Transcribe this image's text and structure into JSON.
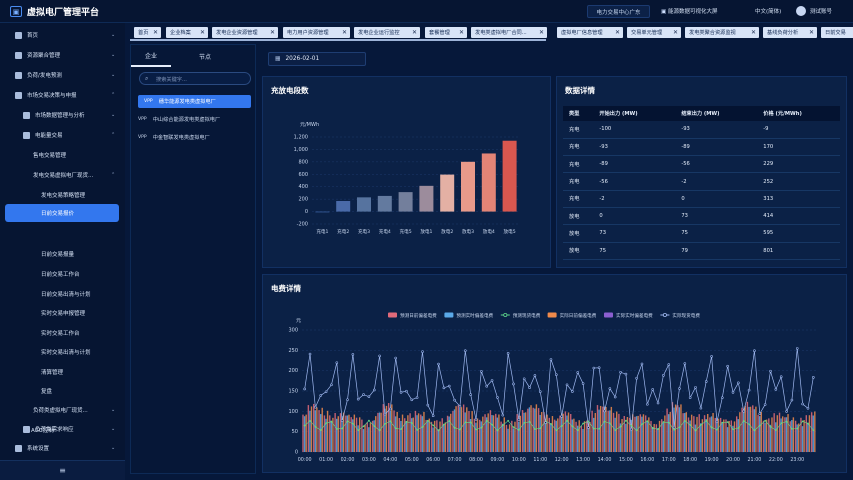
{
  "app": {
    "title": "虚拟电厂管理平台",
    "org": "电力交易中心广东",
    "messages_label": "能源数据可视化大屏",
    "language": "中文(简体)",
    "account": "测试账号"
  },
  "sidebar": {
    "items": [
      {
        "label": "首页"
      },
      {
        "label": "资源聚合管理"
      },
      {
        "label": "负荷/发电预测"
      },
      {
        "label": "市场交易决策与申报"
      },
      {
        "label": "市场数据管理与分析"
      },
      {
        "label": "电能量交易"
      },
      {
        "label": "售电交易管理"
      },
      {
        "label": "发电交易虚拟电厂现货..."
      },
      {
        "label": "发电交易策略管理"
      },
      {
        "label": "日前交易报价"
      },
      {
        "label": "日前交易报量"
      },
      {
        "label": "日前交易工作台"
      },
      {
        "label": "日前交易出清与计划"
      },
      {
        "label": "实时交易申报管理"
      },
      {
        "label": "实时交易工作台"
      },
      {
        "label": "实时交易出清与计划"
      },
      {
        "label": "清算管理"
      },
      {
        "label": "复盘"
      },
      {
        "label": "负荷类虚拟电厂现货..."
      },
      {
        "label": "AGC控制"
      },
      {
        "label": "负荷类需求响应"
      },
      {
        "label": "系统设置"
      }
    ],
    "collapse_icon": "≡"
  },
  "tabs": [
    {
      "label": "首页"
    },
    {
      "label": "企业档案"
    },
    {
      "label": "发电企业资源管理"
    },
    {
      "label": "电力用户资源管理"
    },
    {
      "label": "发电企业运行监控"
    },
    {
      "label": "套餐管理"
    },
    {
      "label": "发电类虚拟电厂合同..."
    },
    {
      "label": "虚拟电厂信息管理"
    },
    {
      "label": "交易单元管理"
    },
    {
      "label": "发电类聚合资源监视"
    },
    {
      "label": "基线负荷分析"
    },
    {
      "label": "日前交易"
    }
  ],
  "tree": {
    "tab_enterprise": "企业",
    "tab_node": "节点",
    "search_placeholder": "搜索关键字...",
    "nodes": [
      {
        "tag": "VPP",
        "label": "穗华能源发电类虚拟电厂"
      },
      {
        "tag": "VPP",
        "label": "中山综合能源发电类虚拟电厂"
      },
      {
        "tag": "VPP",
        "label": "中金智联发电类虚拟电厂"
      }
    ]
  },
  "date": {
    "value": "2026-02-01"
  },
  "bar_panel": {
    "title": "充放电段数"
  },
  "table_panel": {
    "title": "数据详情",
    "columns": [
      "类型",
      "开始出力 (MW)",
      "结束出力 (MW)",
      "价格 (元/MWh)"
    ],
    "rows": [
      [
        "充电",
        "-100",
        "-93",
        "-9"
      ],
      [
        "充电",
        "-93",
        "-89",
        "170"
      ],
      [
        "充电",
        "-89",
        "-56",
        "229"
      ],
      [
        "充电",
        "-56",
        "-2",
        "252"
      ],
      [
        "充电",
        "-2",
        "0",
        "313"
      ],
      [
        "放电",
        "0",
        "73",
        "414"
      ],
      [
        "放电",
        "73",
        "75",
        "595"
      ],
      [
        "放电",
        "75",
        "79",
        "801"
      ]
    ]
  },
  "line_panel": {
    "title": "电费详情"
  },
  "chart_data": [
    {
      "type": "bar",
      "ylabel": "元/MWh",
      "categories": [
        "充电1",
        "充电2",
        "充电3",
        "充电4",
        "充电5",
        "放电1",
        "放电2",
        "放电3",
        "放电4",
        "放电5"
      ],
      "values": [
        -9,
        170,
        229,
        252,
        313,
        414,
        595,
        801,
        935,
        1140
      ],
      "ylim": [
        -200,
        1200
      ],
      "yticks": [
        "-200",
        "0",
        "200",
        "400",
        "600",
        "800",
        "1,000",
        "1,200"
      ],
      "colors": [
        "#3a5f9f",
        "#4a6aa8",
        "#56739f",
        "#637a9f",
        "#737f9c",
        "#9c8c9c",
        "#e4b0a4",
        "#e89a8a",
        "#e38476",
        "#d9574f"
      ],
      "grid": true
    },
    {
      "type": "bar+line",
      "ylabel": "元",
      "ylim": [
        0,
        300
      ],
      "yticks": [
        "0",
        "50",
        "100",
        "150",
        "200",
        "250",
        "300"
      ],
      "legend": [
        "预测日前偏差电费",
        "预测实时偏差电费",
        "预测现货电费",
        "实际日前偏差电费",
        "实际实时偏差电费",
        "实际现货电费"
      ],
      "legend_position": "top-center",
      "series_colors": [
        "#e06a7a",
        "#5aa9e8",
        "#5fd88c",
        "#f08a4b",
        "#8b5fd0",
        "#9fb8f0"
      ],
      "x_ticks": [
        "00:00",
        "01:00",
        "02:00",
        "03:00",
        "04:00",
        "05:00",
        "06:00",
        "07:00",
        "08:00",
        "09:00",
        "10:00",
        "11:00",
        "12:00",
        "13:00",
        "14:00",
        "15:00",
        "16:00",
        "17:00",
        "18:00",
        "19:00",
        "20:00",
        "21:00",
        "22:00",
        "23:00"
      ],
      "samples_per_hour": 4,
      "bar_base_level": 92,
      "bar_amplitude": 25,
      "forecast_line_level": 65,
      "actual_line_min": 55,
      "actual_line_max": 255
    }
  ]
}
